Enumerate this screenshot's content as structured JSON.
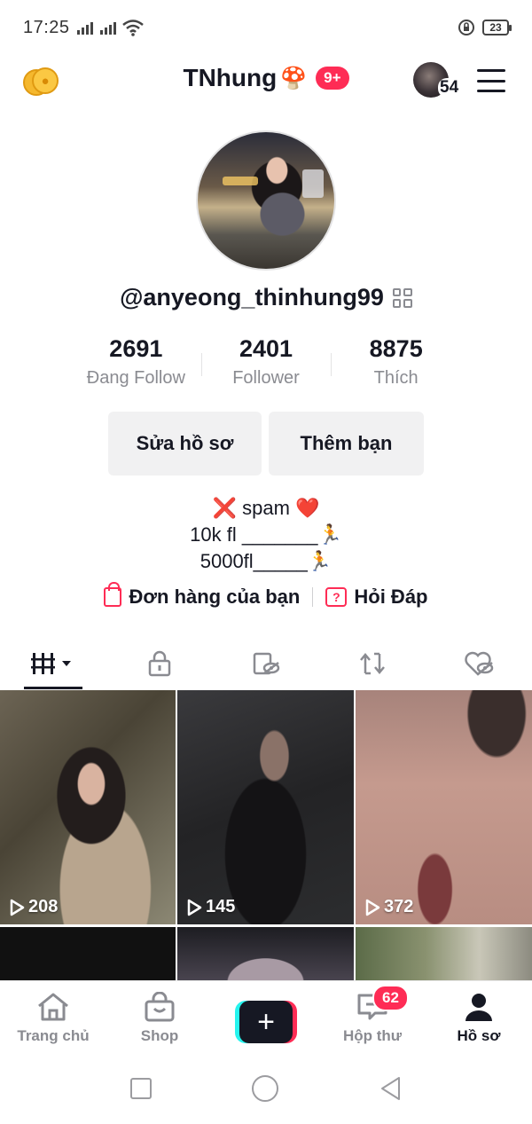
{
  "status_bar": {
    "time": "17:25",
    "battery": "23"
  },
  "header": {
    "username": "TNhung",
    "username_emoji": "🍄",
    "notification_badge": "9+",
    "friends_count": "54"
  },
  "profile": {
    "handle": "@anyeong_thinhung99",
    "stats": [
      {
        "value": "2691",
        "label": "Đang Follow"
      },
      {
        "value": "2401",
        "label": "Follower"
      },
      {
        "value": "8875",
        "label": "Thích"
      }
    ],
    "edit_button": "Sửa hồ sơ",
    "add_friend_button": "Thêm bạn",
    "bio": [
      "❌ spam ❤️",
      "10k fl _______🏃",
      "5000fl_____🏃"
    ],
    "links": {
      "orders": "Đơn hàng của bạn",
      "faq": "Hỏi Đáp"
    }
  },
  "tabs": [
    "videos-tab",
    "private-tab",
    "reposts-hidden-tab",
    "reposts-tab",
    "liked-tab"
  ],
  "videos": [
    {
      "views": "208"
    },
    {
      "views": "145"
    },
    {
      "views": "372"
    },
    {
      "views": ""
    },
    {
      "views": ""
    },
    {
      "views": ""
    }
  ],
  "bottom_nav": {
    "home": "Trang chủ",
    "shop": "Shop",
    "inbox": "Hộp thư",
    "inbox_badge": "62",
    "profile": "Hồ sơ"
  },
  "colors": {
    "accent": "#fe2c55",
    "cyan": "#25f4ee",
    "text": "#161823",
    "muted": "#8a8b91"
  }
}
